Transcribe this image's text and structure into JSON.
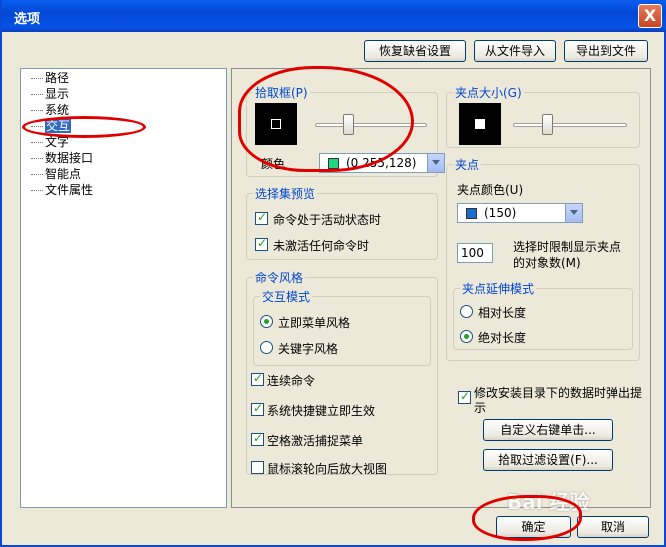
{
  "window": {
    "title": "选项",
    "close_glyph": "X"
  },
  "toolbar": {
    "restore_defaults": "恢复缺省设置",
    "import_from_file": "从文件导入",
    "export_to_file": "导出到文件"
  },
  "tree": {
    "items": [
      "路径",
      "显示",
      "系统",
      "交互",
      "文字",
      "数据接口",
      "智能点",
      "文件属性"
    ],
    "selected_index": 3
  },
  "pickbox": {
    "title": "拾取框(P)",
    "color_label": "颜色",
    "color_value": "(0,255,128)",
    "color_hex": "#1fd67f",
    "slider_level": 0.28
  },
  "gripsize": {
    "title": "夹点大小(G)",
    "slider_level": 0.28
  },
  "selection_preview": {
    "title": "选择集预览",
    "active_cmd": "命令处于活动状态时",
    "no_cmd": "未激活任何命令时"
  },
  "grips": {
    "title": "夹点",
    "color_label": "夹点颜色(U)",
    "color_value": "(150)",
    "color_hex": "#1a6ccf",
    "limit_value": "100",
    "limit_label_1": "选择时限制显示夹点",
    "limit_label_2": "的对象数(M)"
  },
  "grip_stretch": {
    "title": "夹点延伸模式",
    "relative": "相对长度",
    "absolute": "绝对长度"
  },
  "command_style": {
    "title": "命令风格",
    "interaction_title": "交互模式",
    "menu_style": "立即菜单风格",
    "keyword_style": "关键字风格",
    "continuous": "连续命令",
    "shortcut": "系统快捷键立即生效",
    "space_snap": "空格激活捕捉菜单",
    "wheel_zoom": "鼠标滚轮向后放大视图"
  },
  "misc": {
    "install_popup_1": "修改安装目录下的数据时弹出提",
    "install_popup_2": "示",
    "custom_right_click": "自定义右键单击...",
    "pick_filter": "拾取过滤设置(F)..."
  },
  "footer": {
    "ok": "确定",
    "cancel": "取消"
  },
  "watermark": "Bai 经验",
  "colors": {
    "titlebar": "#0348d6",
    "accent": "#0046d5",
    "annotation": "#e10000"
  }
}
